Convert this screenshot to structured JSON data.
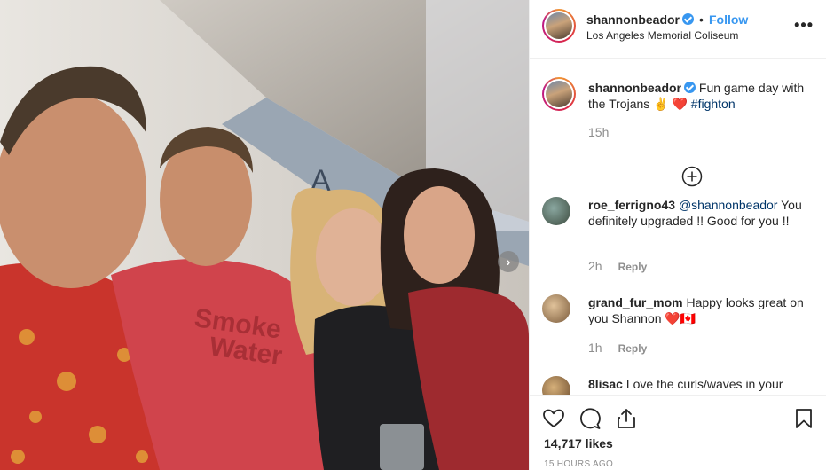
{
  "post": {
    "author": "shannonbeador",
    "follow_label": "Follow",
    "dot": "•",
    "location": "Los Angeles Memorial Coliseum",
    "more_label": "•••",
    "verified": true
  },
  "caption": {
    "username": "shannonbeador",
    "text": "Fun game day with the Trojans ✌️ ❤️ ",
    "hashtag": "#fighton",
    "age": "15h"
  },
  "comments": [
    {
      "username": "roe_ferrigno43",
      "mention": "@shannonbeador",
      "text": " You definitely upgraded !! Good for you !!",
      "age": "2h",
      "reply_label": "Reply"
    },
    {
      "username": "grand_fur_mom",
      "text": " Happy looks great on you Shannon ❤️🇨🇦",
      "age": "1h",
      "reply_label": "Reply"
    },
    {
      "username": "8lisac",
      "text": " Love the curls/waves in your"
    }
  ],
  "stats": {
    "likes": "14,717 likes",
    "timestamp": "15 HOURS AGO"
  },
  "photo": {
    "shirt_text_1": "Smoke",
    "shirt_text_2": "Water",
    "sign_text": "A"
  },
  "colors": {
    "link": "#003569",
    "accent": "#3897f0",
    "muted": "#8e8e8e",
    "heart": "#ed4956"
  },
  "icons": [
    "heart-icon",
    "comment-icon",
    "share-icon",
    "bookmark-icon",
    "add-circle-icon",
    "more-icon",
    "chevron-right-icon",
    "verified-badge-icon"
  ]
}
